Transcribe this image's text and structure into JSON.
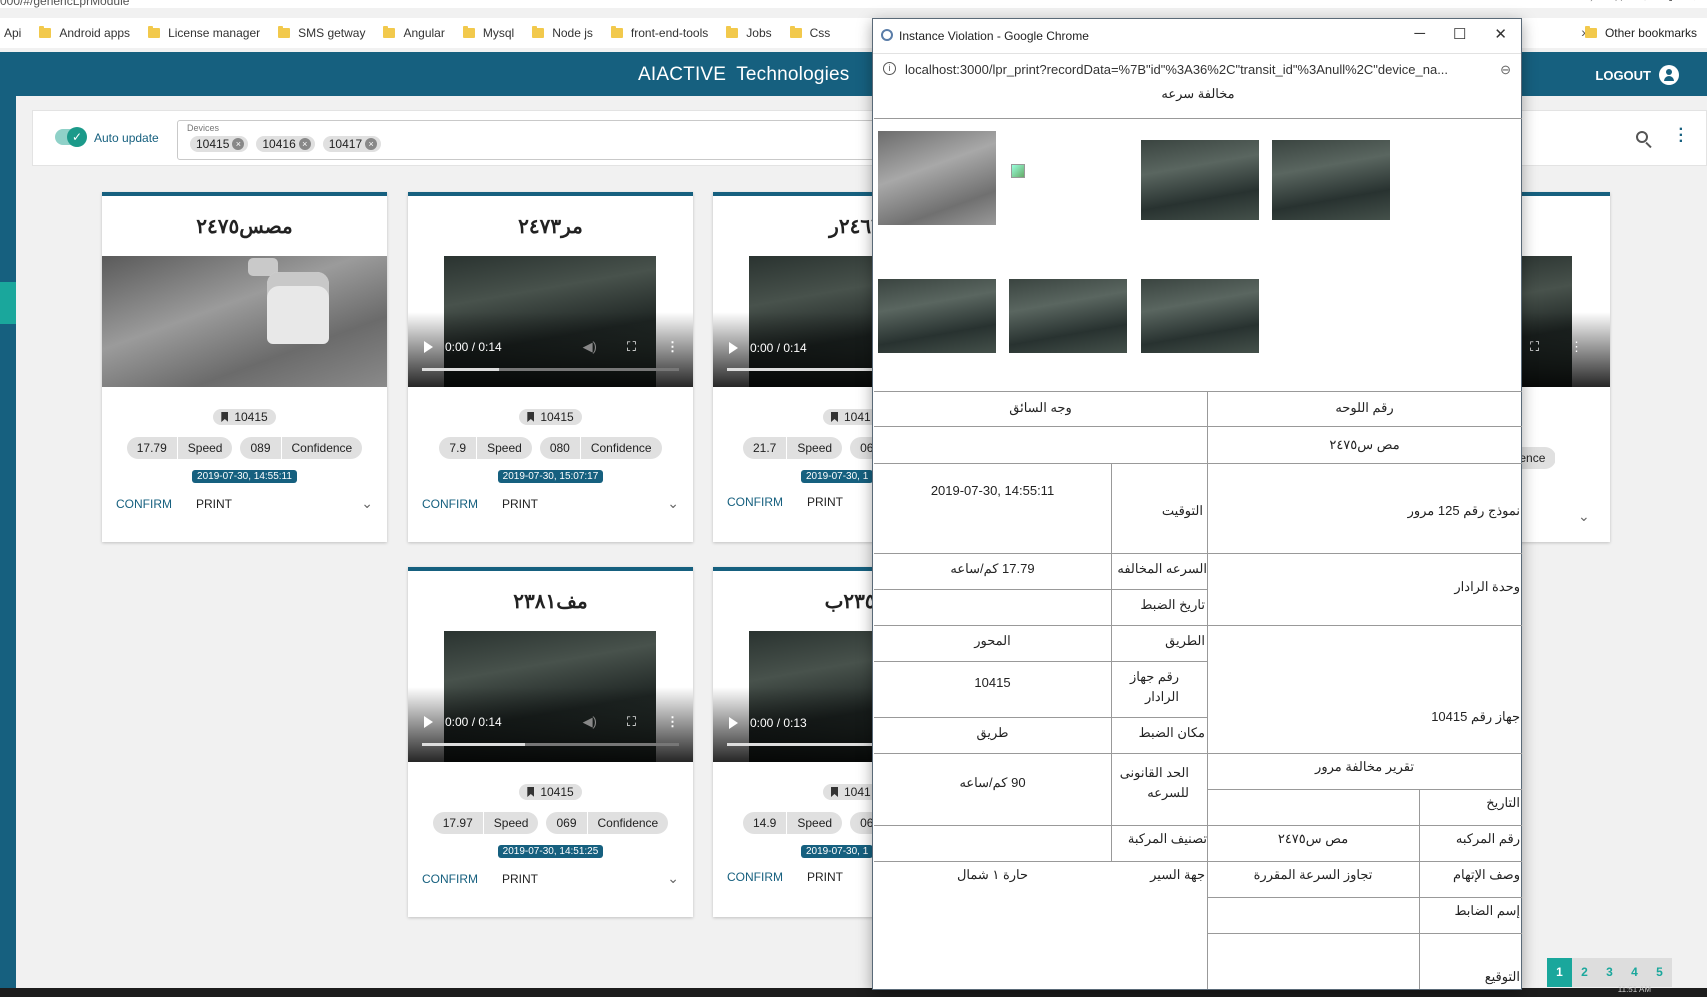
{
  "browser": {
    "url_fragment": "000/#/genericLprModule",
    "bookmarks": [
      "Api",
      "Android apps",
      "License manager",
      "SMS getway",
      "Angular",
      "Mysql",
      "Node js",
      "front-end-tools",
      "Jobs",
      "Css"
    ],
    "more": "»",
    "other_bookmarks": "Other bookmarks"
  },
  "app": {
    "brand_main": "AIACTIVE",
    "brand_sub": "Technologies",
    "logout": "LOGOUT"
  },
  "filters": {
    "auto_update_label": "Auto update",
    "devices_label": "Devices",
    "devices": [
      "10415",
      "10416",
      "10417"
    ]
  },
  "cards": [
    {
      "plate": "مصس٢٤٧٥",
      "device": "10415",
      "speed": "17.79",
      "confidence": "089",
      "date": "2019-07-30, 14:55:11",
      "time": "",
      "progress": 0
    },
    {
      "plate": "مر٢٤٧٣",
      "device": "10415",
      "speed": "7.9",
      "confidence": "080",
      "date": "2019-07-30, 15:07:17",
      "time": "0:00 / 0:14",
      "progress": 0.3
    },
    {
      "plate": "٢٤٦٣ر",
      "device": "1041",
      "speed": "21.7",
      "confidence": "06",
      "date": "2019-07-30, 1",
      "time": "0:00 / 0:14",
      "progress": 0.8
    },
    {
      "plate": "مف٢٣٨١",
      "device": "10415",
      "speed": "17.97",
      "confidence": "069",
      "date": "2019-07-30, 14:51:25",
      "time": "0:00 / 0:14",
      "progress": 0.4
    },
    {
      "plate": "٢٣٥٧ب",
      "device": "1041",
      "speed": "14.9",
      "confidence": "06",
      "date": "2019-07-30, 1",
      "time": "0:00 / 0:13",
      "progress": 0.65
    }
  ],
  "card_labels": {
    "speed": "Speed",
    "confidence": "Confidence",
    "confirm": "CONFIRM",
    "print": "PRINT"
  },
  "right_card": {
    "confidence_partial": "nfidence"
  },
  "pagination": [
    "1",
    "2",
    "3",
    "4",
    "5"
  ],
  "pagination_active": "1",
  "taskbar_time": "11:51 AM",
  "popup": {
    "title": "Instance Violation - Google Chrome",
    "url": "localhost:3000/lpr_print?recordData=%7B\"id\"%3A36%2C\"transit_id\"%3Anull%2C\"device_na...",
    "doc": {
      "heading": "مخالفة سرعه",
      "driver_face": "وجه السائق",
      "plate_number_label": "رقم اللوحه",
      "plate_number": "مص س٢٤٧٥",
      "timestamp": "2019-07-30, 14:55:11",
      "time_label": "التوقيت",
      "form_label": "نموذج رقم 125 مرور",
      "violation_speed": "17.79 كم/ساعه",
      "violation_speed_label": "السرعه المخالفه",
      "radar_unit_label": "وحدة الرادار",
      "seizure_date_label": "تاريخ الضبط",
      "axis": "المحور",
      "road_label": "الطريق",
      "device_no": "10415",
      "device_no_label": "رقم جهاز الرادار",
      "device_text": "جهاز رقم 10415",
      "place": "طريق",
      "place_label": "مكان الضبط",
      "legal_limit": "90 كم/ساعه",
      "legal_limit_label": "الحد القانونى للسرعه",
      "report_title": "تقرير مخالفة مرور",
      "date_label": "التاريخ",
      "vehicle_class_label": "تصنيف المركبة",
      "vehicle_no": "مص س٢٤٧٥",
      "vehicle_no_label": "رقم المركبه",
      "direction": "حارة ١ شمال",
      "direction_label": "جهة السير",
      "charge": "تجاوز السرعة المقررة",
      "charge_label": "وصف الإتهام",
      "officer_label": "إسم الضابط",
      "signature_label": "التوقيع"
    }
  }
}
